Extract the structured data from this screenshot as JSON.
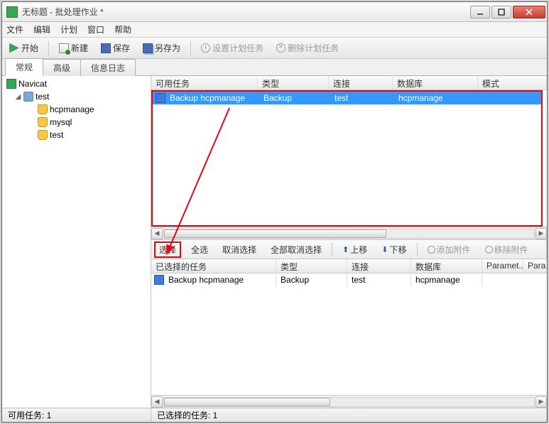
{
  "window": {
    "title": "无标题 - 批处理作业 *"
  },
  "menu": {
    "file": "文件",
    "edit": "编辑",
    "plan": "计划",
    "window": "窗口",
    "help": "帮助"
  },
  "toolbar": {
    "start": "开始",
    "new": "新建",
    "save": "保存",
    "saveas": "另存为",
    "set_schedule": "设置计划任务",
    "del_schedule": "删除计划任务"
  },
  "tabs": {
    "general": "常规",
    "advanced": "高级",
    "log": "信息日志"
  },
  "tree": {
    "root": "Navicat",
    "conn": "test",
    "dbs": [
      "hcpmanage",
      "mysql",
      "test"
    ]
  },
  "available": {
    "headers": {
      "task": "可用任务",
      "type": "类型",
      "conn": "连接",
      "db": "数据库",
      "mode": "模式"
    },
    "rows": [
      {
        "task": "Backup hcpmanage",
        "type": "Backup",
        "conn": "test",
        "db": "hcpmanage",
        "mode": ""
      }
    ]
  },
  "midbar": {
    "select": "选择",
    "select_all": "全选",
    "deselect": "取消选择",
    "deselect_all": "全部取消选择",
    "up": "上移",
    "down": "下移",
    "add_attach": "添加附件",
    "remove_attach": "移除附件"
  },
  "selected": {
    "headers": {
      "task": "已选择的任务",
      "type": "类型",
      "conn": "连接",
      "db": "数据库",
      "param": "Paramet...",
      "para2": "Para"
    },
    "rows": [
      {
        "task": "Backup hcpmanage",
        "type": "Backup",
        "conn": "test",
        "db": "hcpmanage"
      }
    ]
  },
  "status": {
    "left": "可用任务: 1",
    "right": "已选择的任务: 1"
  }
}
